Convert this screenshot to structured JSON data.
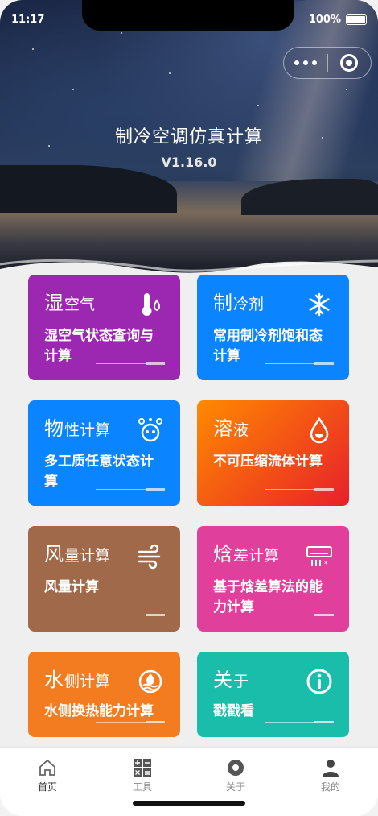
{
  "status": {
    "time": "11:17",
    "battery": "100%"
  },
  "header": {
    "title": "制冷空调仿真计算",
    "version": "V1.16.0"
  },
  "cards": [
    {
      "big": "湿",
      "small": "空气",
      "desc": "湿空气状态查询与计算",
      "color": "#9c27b0",
      "icon": "thermometer-icon"
    },
    {
      "big": "制",
      "small": "冷剂",
      "desc": "常用制冷剂饱和态计算",
      "color": "#0a84ff",
      "icon": "snowflake-icon"
    },
    {
      "big": "物",
      "small": "性计算",
      "desc": "多工质任意状态计算",
      "color": "#0a84ff",
      "icon": "molecule-icon"
    },
    {
      "big": "溶",
      "small": "液",
      "desc": "不可压缩流体计算",
      "color": "#f4511e",
      "icon": "droplet-icon"
    },
    {
      "big": "风",
      "small": "量计算",
      "desc": "风量计算",
      "color": "#a0694a",
      "icon": "wind-icon"
    },
    {
      "big": "焓",
      "small": "差计算",
      "desc": "基于焓差算法的能力计算",
      "color": "#e0409b",
      "icon": "air-conditioner-icon"
    },
    {
      "big": "水",
      "small": "侧计算",
      "desc": "水侧换热能力计算",
      "color": "#f47c20",
      "icon": "water-icon"
    },
    {
      "big": "关",
      "small": "于",
      "desc": "戳戳看",
      "color": "#1abcaa",
      "icon": "info-icon"
    }
  ],
  "tabs": [
    {
      "label": "首页",
      "icon": "home-icon",
      "active": true
    },
    {
      "label": "工具",
      "icon": "calculator-icon",
      "active": false
    },
    {
      "label": "关于",
      "icon": "circle-dot-icon",
      "active": false
    },
    {
      "label": "我的",
      "icon": "user-icon",
      "active": false
    }
  ]
}
